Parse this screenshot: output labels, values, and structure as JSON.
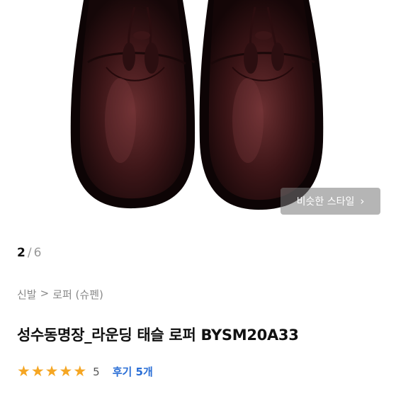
{
  "image": {
    "alt": "product-photo",
    "similar_button_label": "비슷한 스타일",
    "similar_button_icon": "chevron-right-icon"
  },
  "pagination": {
    "current": "2",
    "separator": "/",
    "total": "6"
  },
  "breadcrumb": {
    "category": "신발",
    "arrow": ">",
    "subcategory": "로퍼 (슈펜)"
  },
  "product": {
    "title": "성수동명장_라운딩 태슬 로퍼 BYSM20A33"
  },
  "rating": {
    "stars": 5,
    "value": "5",
    "review_label": "후기 5개",
    "star_color": "#f5a623"
  },
  "colors": {
    "accent": "#2b6fd6",
    "shoe": "#3a1a1c"
  }
}
